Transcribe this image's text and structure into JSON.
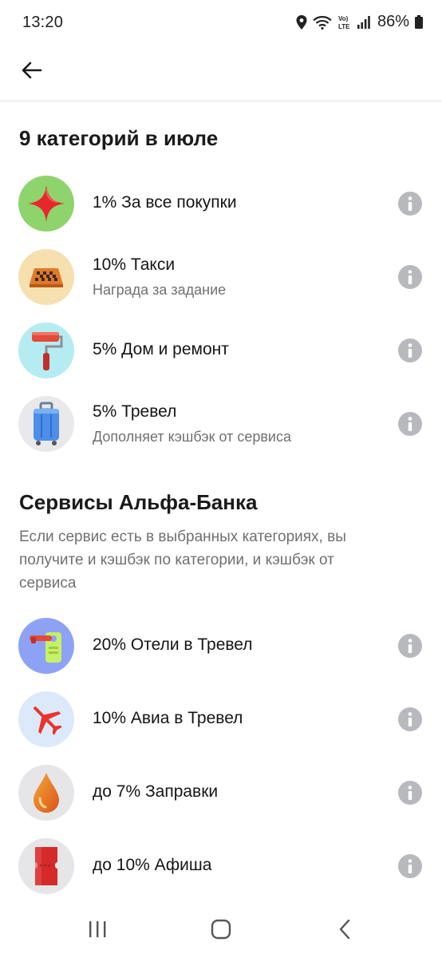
{
  "status_bar": {
    "time": "13:20",
    "battery": "86%",
    "icons": [
      "location-icon",
      "wifi-icon",
      "volte-icon",
      "signal-icon",
      "battery-icon"
    ]
  },
  "app_bar": {
    "back_icon": "arrow-left-icon"
  },
  "categories": {
    "title": "9 категорий в июле",
    "items": [
      {
        "title": "1% За все покупки",
        "subtitle": "",
        "icon": "star-icon",
        "bg": "#8fd36c"
      },
      {
        "title": "10% Такси",
        "subtitle": "Награда за задание",
        "icon": "taxi-sign-icon",
        "bg": "#f7e0b0"
      },
      {
        "title": "5% Дом и ремонт",
        "subtitle": "",
        "icon": "paint-roller-icon",
        "bg": "#b4ecf2"
      },
      {
        "title": "5% Тревел",
        "subtitle": "Дополняет кэшбэк от сервиса",
        "icon": "suitcase-icon",
        "bg": "#e9e9ec"
      }
    ]
  },
  "services": {
    "title": "Сервисы Альфа-Банка",
    "description": "Если сервис есть в выбранных категориях, вы получите и кэшбэк по категории, и кэшбэк от сервиса",
    "items": [
      {
        "title": "20% Отели в Тревел",
        "icon": "door-hanger-icon",
        "bg": "#8ea2f5"
      },
      {
        "title": "10% Авиа в Тревел",
        "icon": "airplane-icon",
        "bg": "#dce9fb"
      },
      {
        "title": "до 7% Заправки",
        "icon": "fuel-drop-icon",
        "bg": "#e6e6e9"
      },
      {
        "title": "до 10% Афиша",
        "icon": "ticket-icon",
        "bg": "#e6e6e9"
      }
    ]
  },
  "nav_bar": {
    "icons": [
      "recent-apps-icon",
      "home-icon",
      "back-nav-icon"
    ]
  },
  "colors": {
    "info_icon": "#b8b9bd",
    "secondary_text": "#707072",
    "divider": "#e3e3e6"
  }
}
